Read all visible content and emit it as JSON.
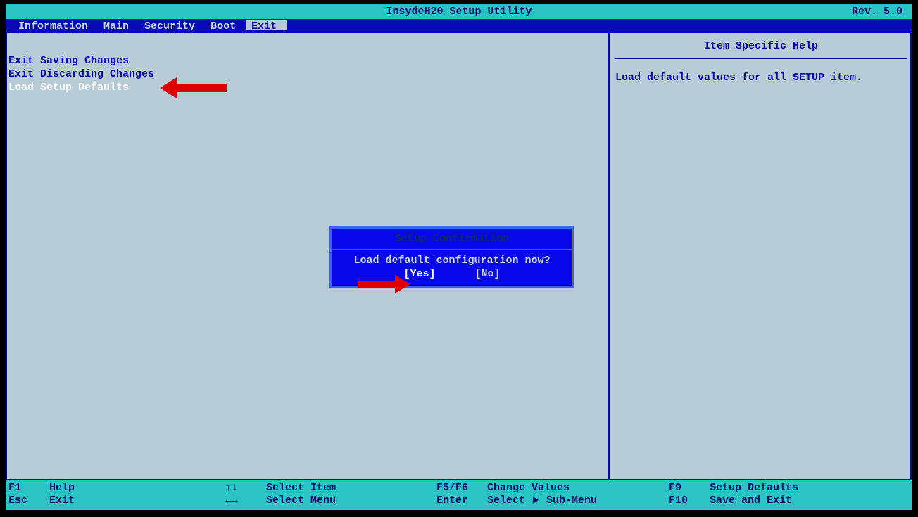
{
  "title_bar": {
    "center": "InsydeH20 Setup Utility",
    "right": "Rev. 5.0"
  },
  "menu": {
    "items": [
      "Information",
      "Main",
      "Security",
      "Boot",
      "Exit"
    ],
    "active_index": 4
  },
  "exit_options": {
    "items": [
      "Exit Saving Changes",
      "Exit Discarding Changes",
      "Load Setup Defaults"
    ],
    "selected_index": 2
  },
  "help_panel": {
    "title": "Item Specific Help",
    "body": "Load default values for all SETUP item."
  },
  "dialog": {
    "title": "Setup Confirmation",
    "message": "Load default configuration now?",
    "yes": "[Yes]",
    "no": "[No]",
    "selected": "yes"
  },
  "footer": {
    "col1": {
      "k1": "F1",
      "l1": "Help",
      "k2": "Esc",
      "l2": "Exit"
    },
    "col2": {
      "k1": "↑↓",
      "l1": "Select Item",
      "k2": "←→",
      "l2": "Select Menu"
    },
    "col3": {
      "k1": "F5/F6",
      "l1": "Change Values",
      "k2": "Enter",
      "l2_a": "Select",
      "l2_b": "Sub-Menu"
    },
    "col4": {
      "k1": "F9",
      "l1": "Setup Defaults",
      "k2": "F10",
      "l2": "Save and Exit"
    }
  }
}
